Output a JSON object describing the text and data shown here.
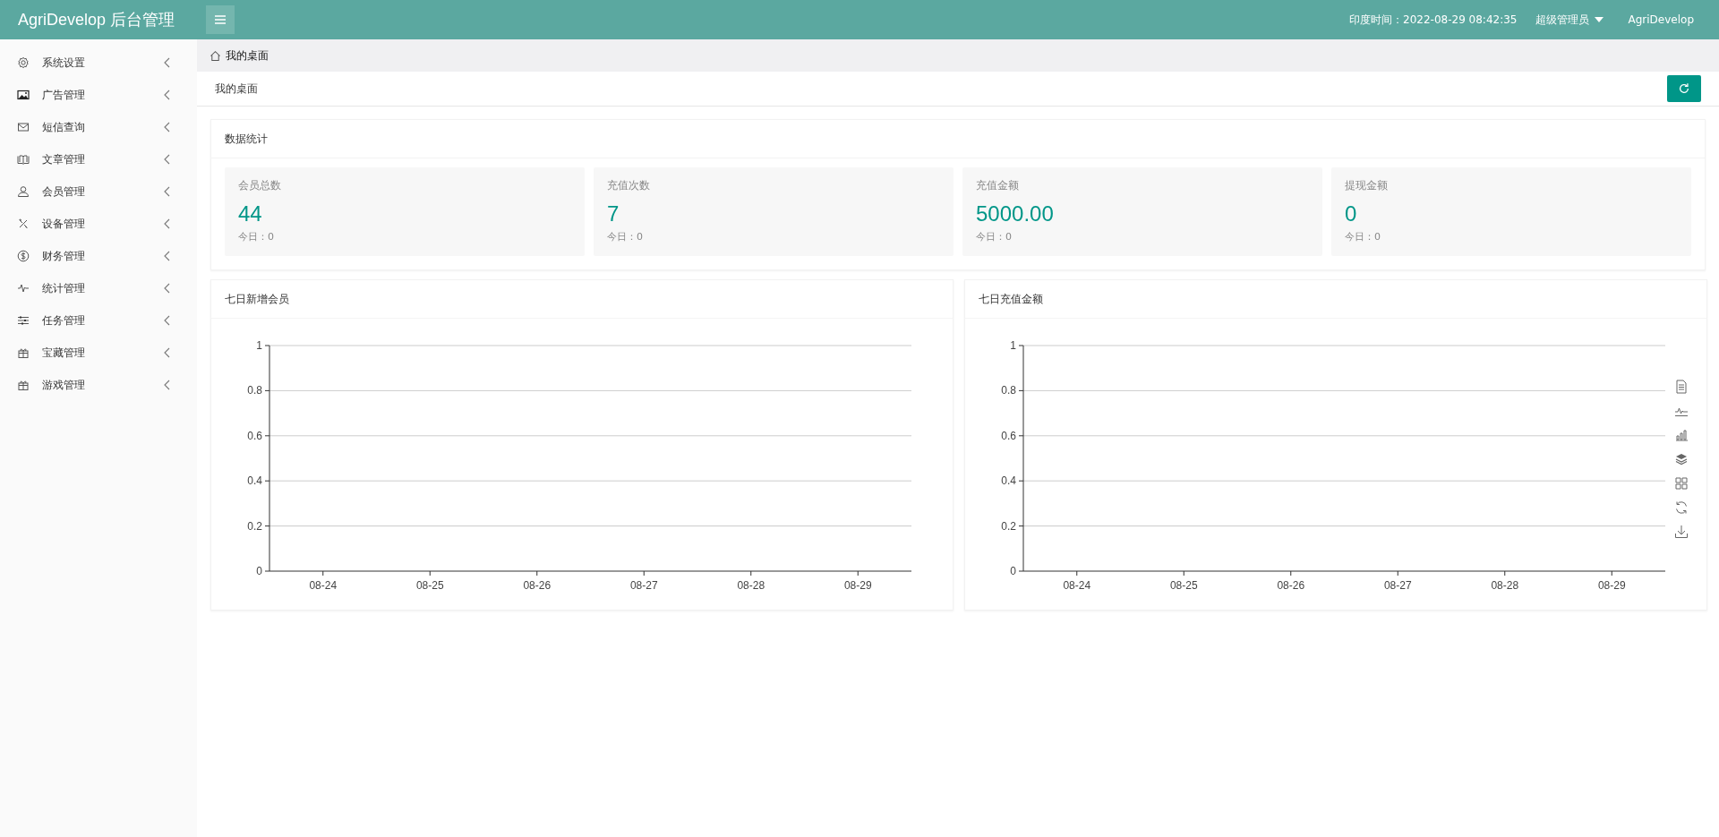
{
  "header": {
    "title": "AgriDevelop 后台管理",
    "time_label": "印度时间：2022-08-29 08:42:35",
    "role": "超级管理员",
    "user": "AgriDevelop"
  },
  "sidebar": {
    "items": [
      {
        "label": "系统设置",
        "expanded": false
      },
      {
        "label": "广告管理",
        "expanded": false
      },
      {
        "label": "短信查询",
        "expanded": false
      },
      {
        "label": "文章管理",
        "expanded": false
      },
      {
        "label": "会员管理",
        "expanded": false
      },
      {
        "label": "设备管理",
        "expanded": false
      },
      {
        "label": "财务管理",
        "expanded": false
      },
      {
        "label": "统计管理",
        "expanded": false
      },
      {
        "label": "任务管理",
        "expanded": false
      },
      {
        "label": "宝藏管理",
        "expanded": false
      },
      {
        "label": "游戏管理",
        "expanded": false
      }
    ]
  },
  "breadcrumb": "我的桌面",
  "page_title": "我的桌面",
  "stats": {
    "title": "数据统计",
    "cards": [
      {
        "label": "会员总数",
        "value": "44",
        "today": "今日：0"
      },
      {
        "label": "充值次数",
        "value": "7",
        "today": "今日：0"
      },
      {
        "label": "充值金额",
        "value": "5000.00",
        "today": "今日：0"
      },
      {
        "label": "提现金额",
        "value": "0",
        "today": "今日：0"
      }
    ]
  },
  "charts": [
    {
      "title": "七日新增会员",
      "toolbox": false,
      "chart_data": {
        "type": "line",
        "grid": true,
        "categories": [
          "08-24",
          "08-25",
          "08-26",
          "08-27",
          "08-28",
          "08-29"
        ],
        "ylim": [
          0,
          1
        ],
        "yticks": [
          0,
          0.2,
          0.4,
          0.6,
          0.8,
          1
        ]
      }
    },
    {
      "title": "七日充值金额",
      "toolbox": true,
      "chart_data": {
        "type": "line",
        "grid": true,
        "categories": [
          "08-24",
          "08-25",
          "08-26",
          "08-27",
          "08-28",
          "08-29"
        ],
        "ylim": [
          0,
          1
        ],
        "yticks": [
          0,
          0.2,
          0.4,
          0.6,
          0.8,
          1
        ]
      }
    }
  ]
}
